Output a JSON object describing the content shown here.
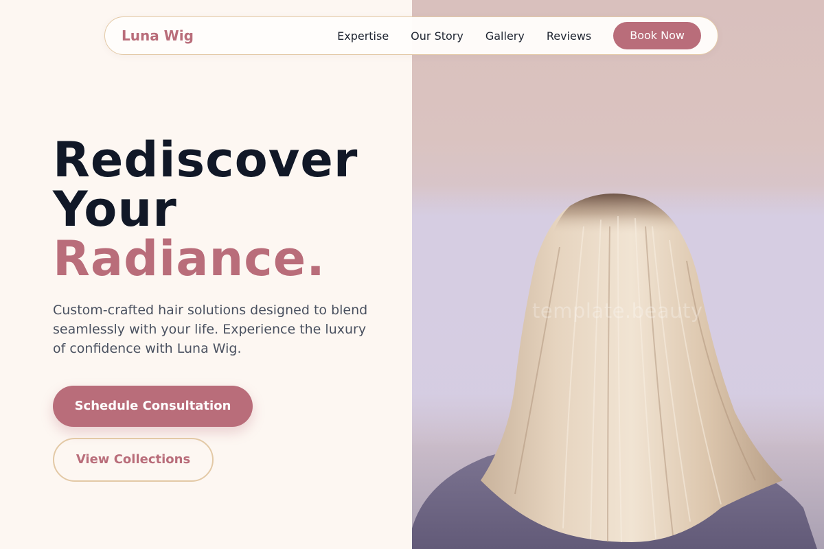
{
  "brand": {
    "name": "Luna Wig"
  },
  "nav": {
    "links": [
      "Expertise",
      "Our Story",
      "Gallery",
      "Reviews"
    ],
    "cta": "Book Now"
  },
  "hero": {
    "title_line1": "Rediscover",
    "title_line2": "Your",
    "title_accent": "Radiance.",
    "subtitle": "Custom-crafted hair solutions designed to blend seamlessly with your life. Experience the luxury of confidence with Luna Wig.",
    "primary_cta": "Schedule Consultation",
    "secondary_cta": "View Collections"
  },
  "photo": {
    "watermark": "template.beauty"
  },
  "colors": {
    "accent": "#b96d7a",
    "heading": "#111827",
    "background": "#fdf7f2",
    "border": "#e3c9a6"
  }
}
